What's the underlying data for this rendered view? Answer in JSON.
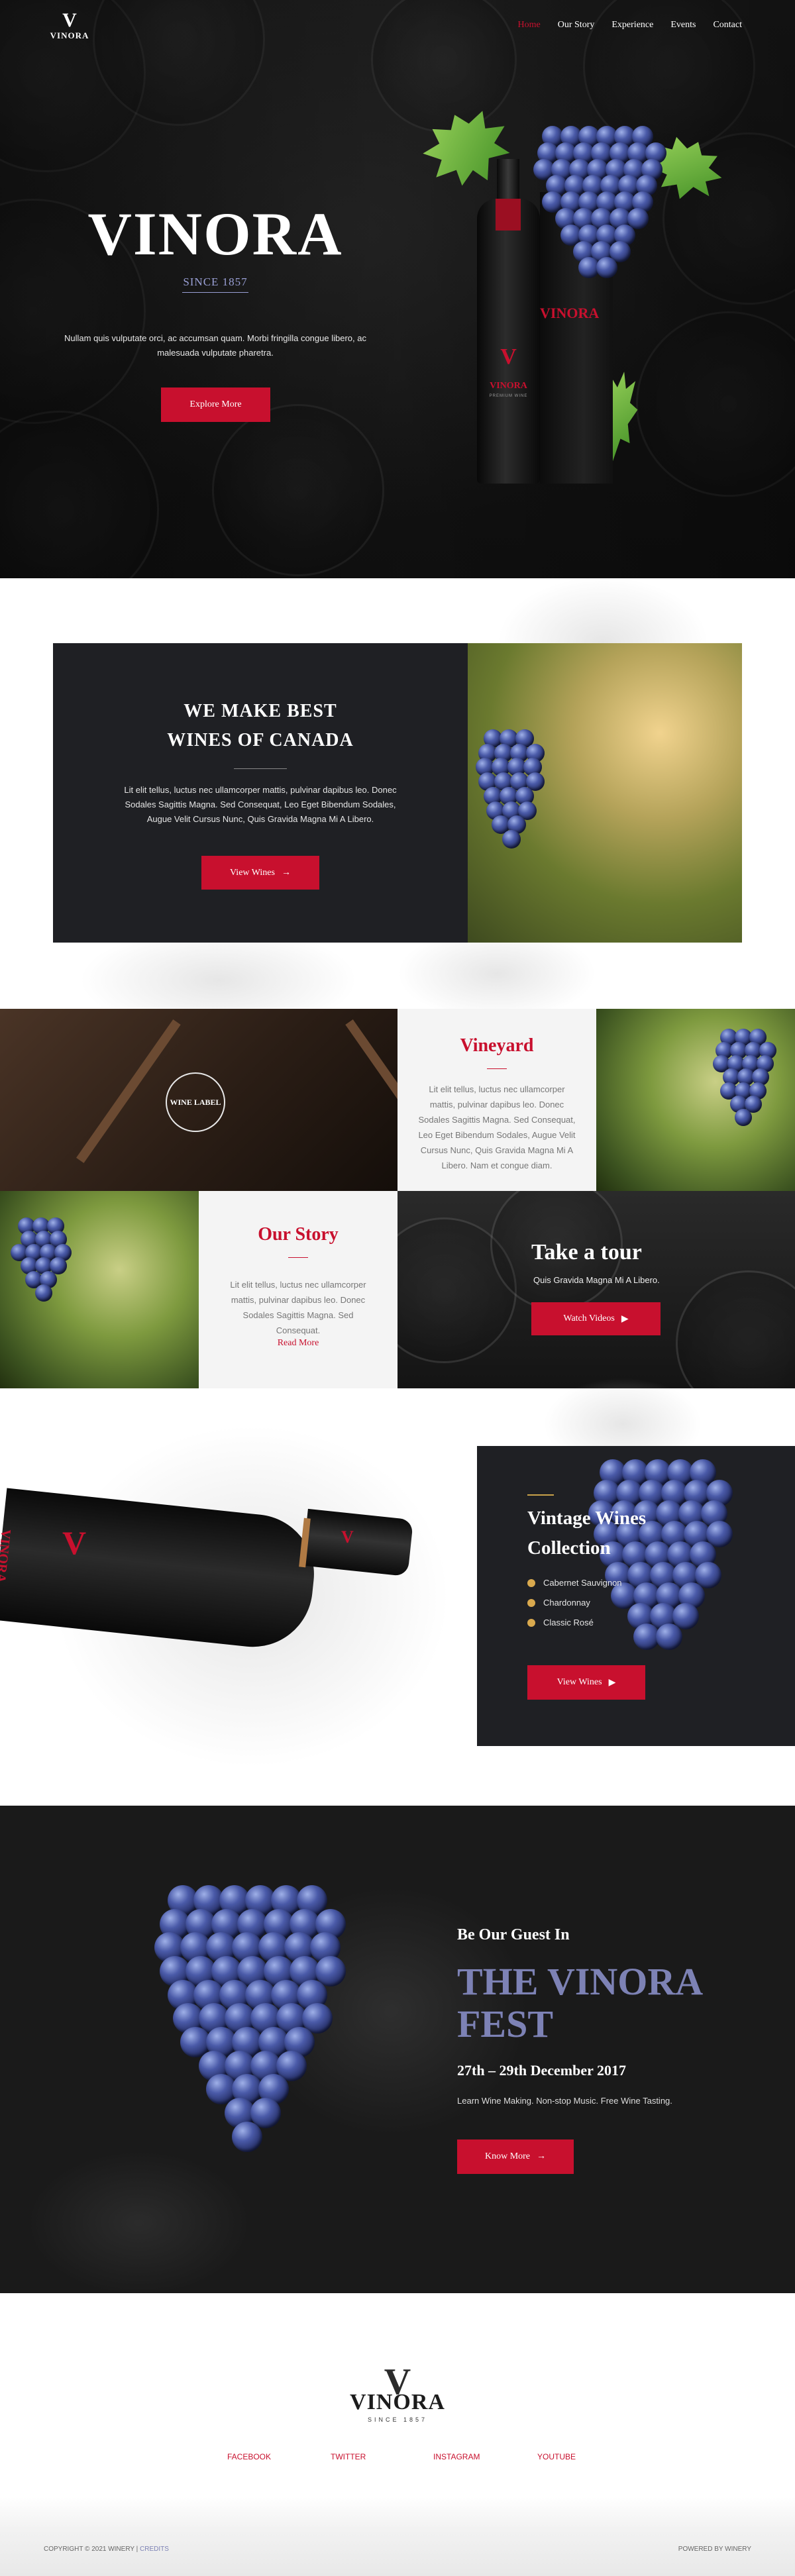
{
  "brand": {
    "mark": "V",
    "name": "VINORA",
    "since_footer": "SINCE 1857"
  },
  "nav": {
    "items": [
      {
        "label": "Home",
        "active": true
      },
      {
        "label": "Our Story",
        "active": false
      },
      {
        "label": "Experience",
        "active": false
      },
      {
        "label": "Events",
        "active": false
      },
      {
        "label": "Contact",
        "active": false
      }
    ]
  },
  "hero": {
    "title": "VINORA",
    "since": "SINCE 1857",
    "description": "Nullam quis vulputate orci, ac accumsan quam. Morbi fringilla congue libero, ac malesuada vulputate pharetra.",
    "button": "Explore More",
    "bottle_label": "V",
    "box_label": "VINORA",
    "bottle_sub": "VINORA",
    "bottle_caption": "PREMIUM WINE"
  },
  "best": {
    "title_line1": "WE MAKE BEST",
    "title_line2": "WINES OF CANADA",
    "description": "Lit elit tellus, luctus nec ullamcorper mattis, pulvinar dapibus leo. Donec Sodales Sagittis Magna. Sed Consequat, Leo Eget Bibendum Sodales, Augue Velit Cursus Nunc, Quis Gravida Magna Mi A Libero.",
    "button": "View Wines"
  },
  "grid": {
    "wine_label": "WINE LABEL",
    "vineyard": {
      "title": "Vineyard",
      "text": "Lit elit tellus, luctus nec ullamcorper mattis, pulvinar dapibus leo. Donec Sodales Sagittis Magna. Sed Consequat, Leo Eget Bibendum Sodales, Augue Velit Cursus Nunc, Quis Gravida Magna Mi A Libero. Nam et congue diam."
    },
    "story": {
      "title": "Our Story",
      "text": "Lit elit tellus, luctus nec ullamcorper mattis, pulvinar dapibus leo. Donec Sodales Sagittis Magna. Sed Consequat.",
      "link": "Read More"
    },
    "tour": {
      "title": "Take a tour",
      "text": "Quis Gravida Magna Mi A Libero.",
      "button": "Watch Videos"
    }
  },
  "vintage": {
    "title_line1": "Vintage Wines",
    "title_line2": "Collection",
    "items": [
      "Cabernet Sauvignon",
      "Chardonnay",
      "Classic Rosé"
    ],
    "button": "View Wines",
    "bottle_label": "V",
    "bottle_text": "VINORA"
  },
  "fest": {
    "guest": "Be Our Guest In",
    "title_line1": "THE VINORA",
    "title_line2": "FEST",
    "date": "27th – 29th December 2017",
    "description": "Learn Wine Making. Non-stop Music. Free Wine Tasting.",
    "button": "Know More"
  },
  "footer": {
    "social": [
      "FACEBOOK",
      "TWITTER",
      "INSTAGRAM",
      "YOUTUBE"
    ],
    "copyright": "COPYRIGHT © 2021 WINERY |",
    "credits": "CREDITS",
    "powered": "POWERED BY WINERY"
  },
  "colors": {
    "accent": "#c8102e",
    "lavender": "#7d82b5",
    "dark_panel": "#1f2024",
    "gold": "#d9a94e"
  },
  "icons": {
    "arrow": "arrow-right-icon",
    "play": "play-icon"
  }
}
